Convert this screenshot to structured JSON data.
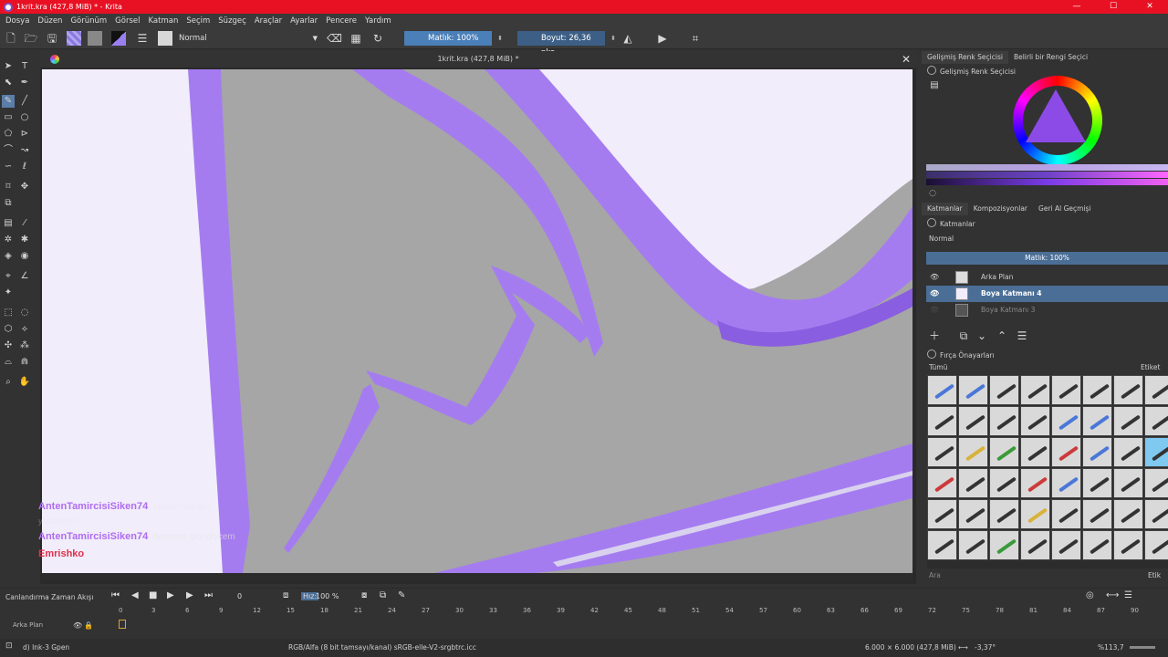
{
  "window": {
    "title": "1krit.kra (427,8 MiB) * - Krita"
  },
  "menu": [
    "Dosya",
    "Düzen",
    "Görünüm",
    "Görsel",
    "Katman",
    "Seçim",
    "Süzgeç",
    "Araçlar",
    "Ayarlar",
    "Pencere",
    "Yardım"
  ],
  "toolbar": {
    "blend_mode": "Normal",
    "opacity_label": "Matlık: 100%",
    "size_label": "Boyut: 26,36 pks"
  },
  "document": {
    "tab_title": "1krit.kra (427,8 MiB) *"
  },
  "colors": {
    "stroke": "#a57cf0",
    "stroke_dark": "#8a5ee0",
    "canvas_gray": "#a6a6a6",
    "paper": "#f0ecfb",
    "accent": "#4a6e96"
  },
  "chat": [
    {
      "user": "AntenTamircisiSiken74",
      "message": "tasarım için güç"
    },
    {
      "user": "",
      "message": "yapabilirsin"
    },
    {
      "user": "AntenTamircisiSiken74",
      "message": "harmanı gibi diycem"
    },
    {
      "user": "Emrishko",
      "message": ""
    }
  ],
  "color_selector": {
    "tabs": [
      "Gelişmiş Renk Seçicisi",
      "Belirli bir Rengi Seçici"
    ],
    "header": "Gelişmiş Renk Seçicisi"
  },
  "layers": {
    "tabs": [
      "Katmanlar",
      "Kompozisyonlar",
      "Geri Al Geçmişi"
    ],
    "header": "Katmanlar",
    "mode": "Normal",
    "opacity": "Matlık:  100%",
    "items": [
      {
        "name": "Arka Plan",
        "visible": true,
        "selected": false
      },
      {
        "name": "Boya Katmanı 4",
        "visible": true,
        "selected": true
      },
      {
        "name": "Boya Katmanı 3",
        "visible": false,
        "selected": false
      }
    ]
  },
  "brush_presets": {
    "header": "Fırça Önayarları",
    "filter": "Tümü",
    "tag_label": "Etiket",
    "search_placeholder": "Ara",
    "etiket_short": "Etik"
  },
  "timeline": {
    "title": "Canlandırma Zaman Akışı",
    "frame": "0",
    "speed_label": "Hız:",
    "speed_value": "100 %",
    "ruler": [
      "0",
      "3",
      "6",
      "9",
      "12",
      "15",
      "18",
      "21",
      "24",
      "27",
      "30",
      "33",
      "36",
      "39",
      "42",
      "45",
      "48",
      "51",
      "54",
      "57",
      "60",
      "63",
      "66",
      "69",
      "72",
      "75",
      "78",
      "81",
      "84",
      "87",
      "90"
    ],
    "layer_name": "Arka Plan"
  },
  "status": {
    "brush": "d) Ink-3 Gpen",
    "color_profile": "RGB/Alfa (8 bit tamsayı/kanal)  sRGB-elle-V2-srgbtrc.icc",
    "image_size": "6.000 × 6.000 (427,8 MiB)",
    "rotation": "-3,37°",
    "zoom": "%113,7"
  }
}
